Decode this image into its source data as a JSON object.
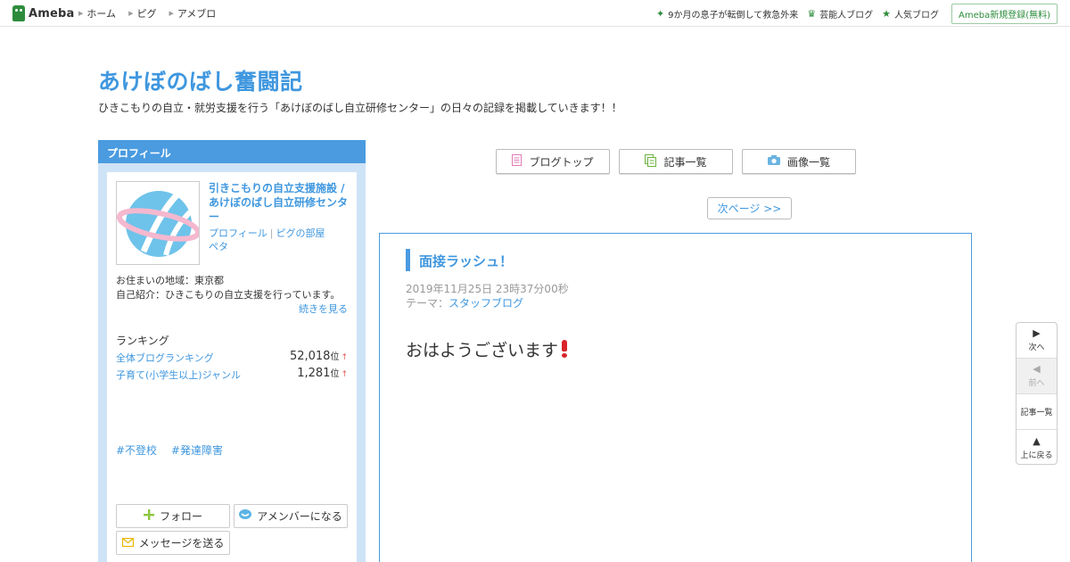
{
  "topbar": {
    "logo_text": "Ameba",
    "nav": [
      "ホーム",
      "ピグ",
      "アメブロ"
    ],
    "right_links": [
      "9か月の息子が転倒して救急外来",
      "芸能人ブログ",
      "人気ブログ"
    ],
    "signup_label": "Ameba新規登録(無料)"
  },
  "blog": {
    "title": "あけぼのばし奮闘記",
    "description": "ひきこもりの自立・就労支援を行う「あけぼのばし自立研修センター」の日々の記録を掲載していきます！！"
  },
  "profile": {
    "header": "プロフィール",
    "name": "引きこもりの自立支援施設 / あけぼのばし自立研修センター",
    "link_profile": "プロフィール",
    "link_room": "ピグの部屋",
    "link_peta": "ペタ",
    "location": "お住まいの地域：東京都",
    "intro": "自己紹介：ひきこもりの自立支援を行っています。",
    "more": "続きを見る",
    "ranking_title": "ランキング",
    "rankings": [
      {
        "label": "全体ブログランキング",
        "value": "52,018",
        "unit": "位",
        "arrow": "↑"
      },
      {
        "label": "子育て(小学生以上)ジャンル",
        "value": "1,281",
        "unit": "位",
        "arrow": "↑"
      }
    ],
    "tags": [
      "#不登校",
      "#発達障害"
    ],
    "follow_label": "フォロー",
    "amember_label": "アメンバーになる",
    "message_label": "メッセージを送る"
  },
  "main": {
    "nav_buttons": [
      "ブログトップ",
      "記事一覧",
      "画像一覧"
    ],
    "next_page": "次ページ >>",
    "article": {
      "title": "面接ラッシュ！",
      "date": "2019年11月25日 23時37分00秒",
      "theme_label": "テーマ：",
      "theme": "スタッフブログ",
      "body": "おはようございます"
    }
  },
  "sidenav": {
    "next": "次へ",
    "prev": "前へ",
    "list": "記事一覧",
    "top": "上に戻る"
  },
  "colors": {
    "brand_green": "#2d8c3c",
    "accent_blue": "#3f97df",
    "sidebar_bg": "#cfe3f7",
    "exclaim_red": "#d9232a"
  }
}
